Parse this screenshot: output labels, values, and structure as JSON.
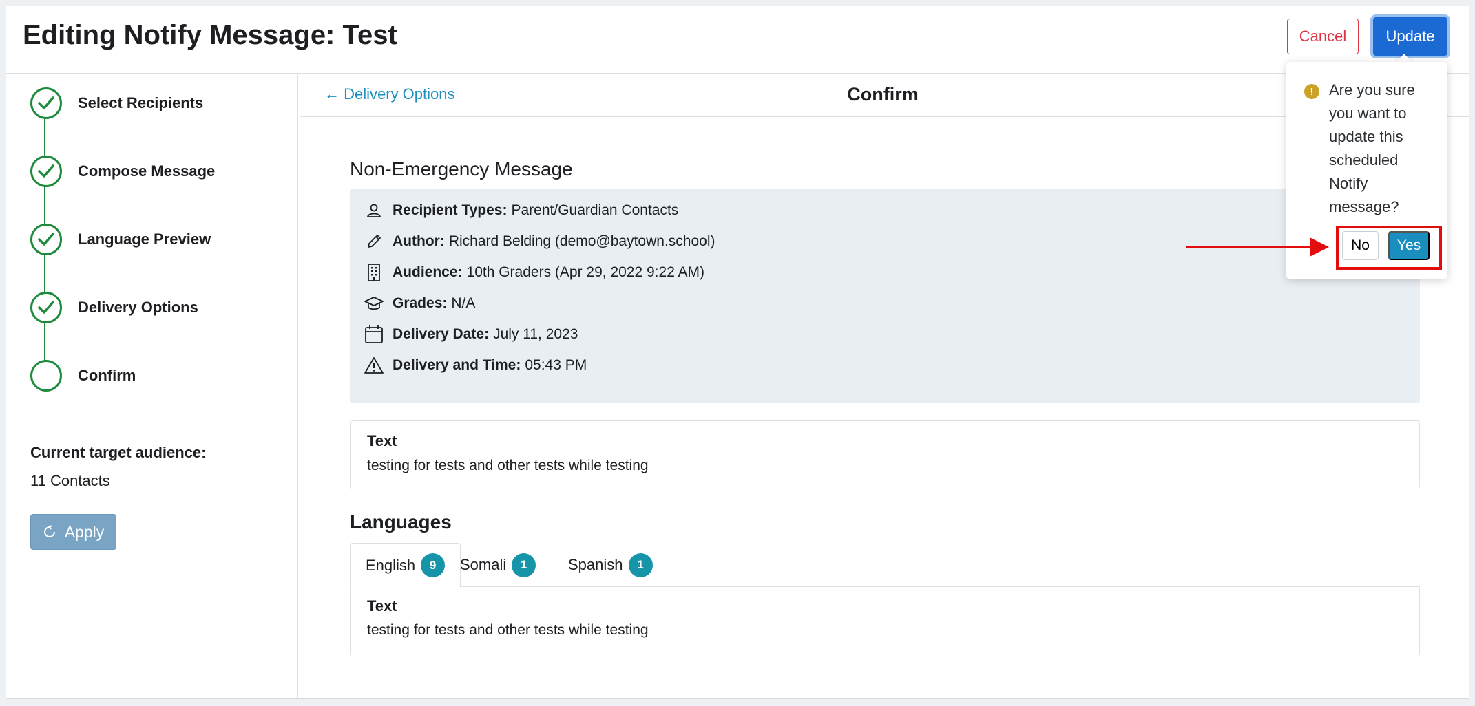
{
  "header": {
    "title": "Editing Notify Message: Test",
    "cancel_label": "Cancel",
    "update_label": "Update"
  },
  "sidebar": {
    "steps": [
      {
        "label": "Select Recipients",
        "completed": true
      },
      {
        "label": "Compose Message",
        "completed": true
      },
      {
        "label": "Language Preview",
        "completed": true
      },
      {
        "label": "Delivery Options",
        "completed": true
      },
      {
        "label": "Confirm",
        "completed": false
      }
    ],
    "audience_label": "Current target audience:",
    "audience_value": "11 Contacts",
    "apply_label": "Apply"
  },
  "main": {
    "back_link": "← Delivery Options",
    "title": "Confirm",
    "section_title": "Non-Emergency Message",
    "info": [
      {
        "icon": "person-icon",
        "label": "Recipient Types:",
        "value": "Parent/Guardian Contacts"
      },
      {
        "icon": "pencil-icon",
        "label": "Author:",
        "value": "Richard Belding (demo@baytown.school)"
      },
      {
        "icon": "building-icon",
        "label": "Audience:",
        "value": "10th Graders (Apr 29, 2022 9:22 AM)"
      },
      {
        "icon": "graduation-cap-icon",
        "label": "Grades:",
        "value": "N/A"
      },
      {
        "icon": "calendar-icon",
        "label": "Delivery Date:",
        "value": "July 11, 2023"
      },
      {
        "icon": "warning-icon",
        "label": "Delivery and Time:",
        "value": "05:43 PM"
      }
    ],
    "text_card": {
      "heading": "Text",
      "body": "testing for tests and other tests while testing"
    },
    "languages_title": "Languages",
    "tabs": [
      {
        "label": "English",
        "count": "9",
        "active": true
      },
      {
        "label": "Somali",
        "count": "1",
        "active": false
      },
      {
        "label": "Spanish",
        "count": "1",
        "active": false
      }
    ],
    "lang_card": {
      "heading": "Text",
      "body": "testing for tests and other tests while testing"
    }
  },
  "popover": {
    "icon": "exclamation-icon",
    "message": "Are you sure you want to update this scheduled Notify message?",
    "no_label": "No",
    "yes_label": "Yes"
  },
  "colors": {
    "primary": "#1b6ad3",
    "success": "#1e8a3c",
    "danger": "#dc3545",
    "info": "#1a8fbf",
    "badge": "#1694a8",
    "annotation": "#e30d0d"
  }
}
